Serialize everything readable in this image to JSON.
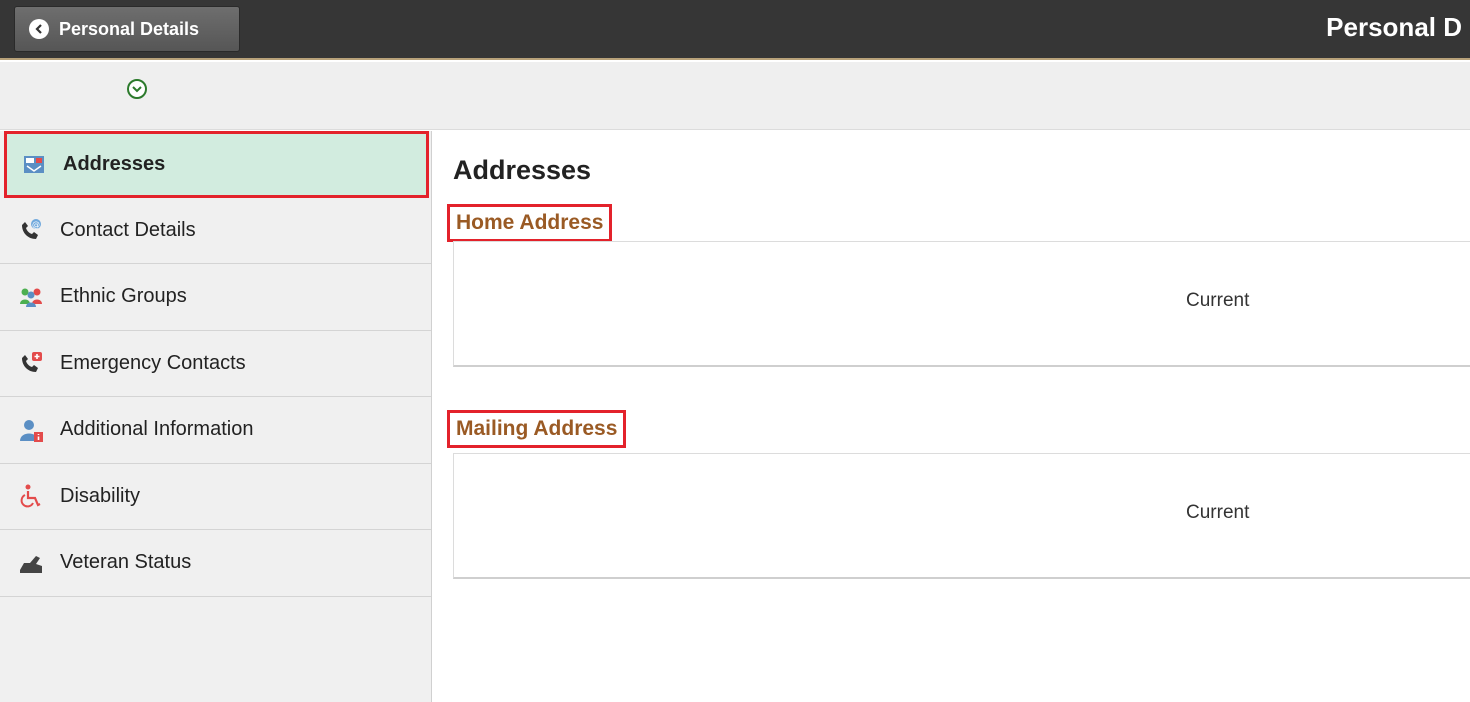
{
  "header": {
    "back_label": "Personal Details",
    "page_title": "Personal D"
  },
  "sidebar": {
    "items": [
      {
        "label": "Addresses",
        "icon": "address-card-icon",
        "active": true
      },
      {
        "label": "Contact Details",
        "icon": "phone-email-icon",
        "active": false
      },
      {
        "label": "Ethnic Groups",
        "icon": "people-group-icon",
        "active": false
      },
      {
        "label": "Emergency Contacts",
        "icon": "phone-emergency-icon",
        "active": false
      },
      {
        "label": "Additional Information",
        "icon": "person-info-icon",
        "active": false
      },
      {
        "label": "Disability",
        "icon": "wheelchair-icon",
        "active": false
      },
      {
        "label": "Veteran Status",
        "icon": "veteran-icon",
        "active": false
      }
    ]
  },
  "main": {
    "title": "Addresses",
    "sections": [
      {
        "title": "Home Address",
        "status": "Current"
      },
      {
        "title": "Mailing Address",
        "status": "Current"
      }
    ]
  },
  "colors": {
    "header_bg": "#363636",
    "active_nav_bg": "#d2ecdf",
    "highlight_border": "#e3222b",
    "section_title": "#9a5a24"
  }
}
